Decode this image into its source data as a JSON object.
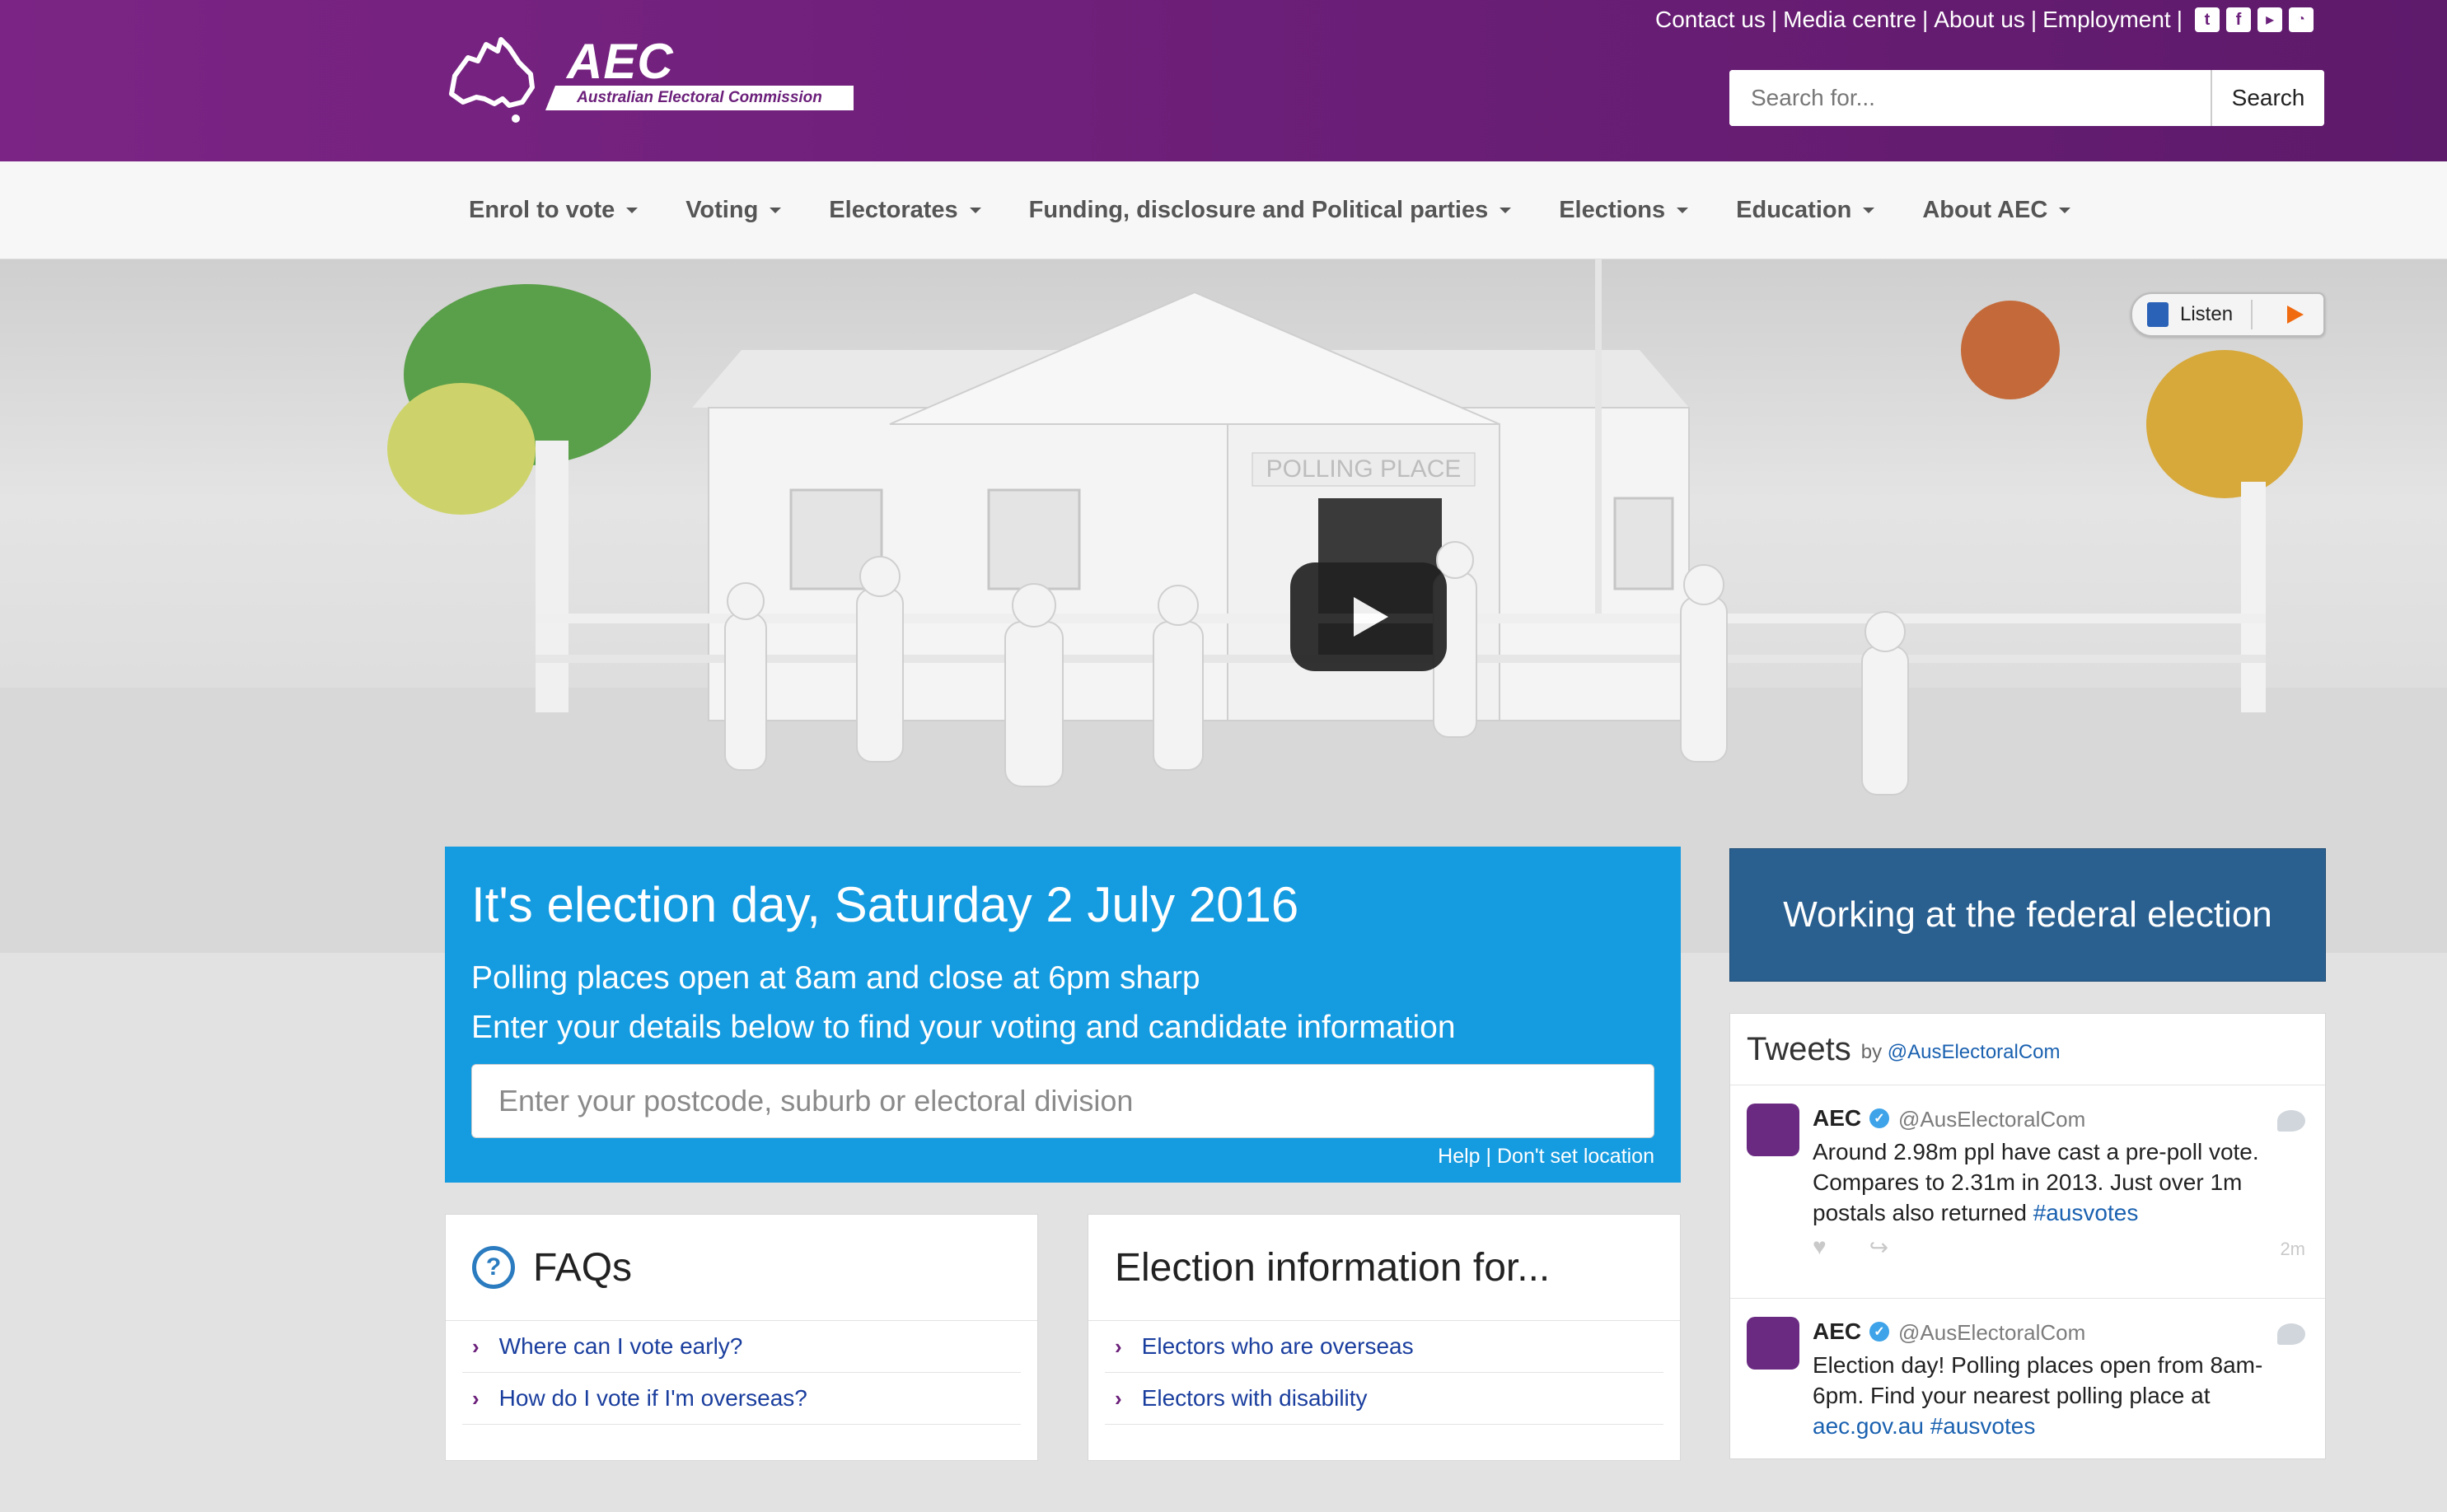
{
  "header": {
    "logo_text": "AEC",
    "logo_subtitle": "Australian Electoral Commission",
    "links": [
      "Contact us",
      "Media centre",
      "About us",
      "Employment"
    ],
    "link_separator": "|",
    "social_icons": [
      "twitter-icon",
      "facebook-icon",
      "youtube-icon",
      "rss-icon"
    ],
    "search": {
      "placeholder": "Search for...",
      "button_label": "Search"
    },
    "brand_color": "#6b1f7a"
  },
  "nav": {
    "items": [
      {
        "label": "Enrol to vote"
      },
      {
        "label": "Voting"
      },
      {
        "label": "Electorates"
      },
      {
        "label": "Funding, disclosure and Political parties"
      },
      {
        "label": "Elections"
      },
      {
        "label": "Education"
      },
      {
        "label": "About AEC"
      }
    ]
  },
  "hero": {
    "sign_text": "POLLING PLACE",
    "listen_label": "Listen",
    "play_icon": "play-icon"
  },
  "election": {
    "title": "It's election day, Saturday 2 July 2016",
    "line1": "Polling places open at 8am and close at 6pm sharp",
    "line2": "Enter your details below to find your voting and candidate information",
    "input_placeholder": "Enter your postcode, suburb or electoral division",
    "help_link": "Help",
    "separator": "|",
    "dont_set_link": "Don't set location",
    "accent_color": "#159be0"
  },
  "working": {
    "label": "Working at the federal election",
    "color": "#2a6090"
  },
  "tweets": {
    "title": "Tweets",
    "by": "by",
    "handle_link": "@AusElectoralCom",
    "items": [
      {
        "name": "AEC",
        "handle": "@AusElectoralCom",
        "text": "Around 2.98m ppl have cast a pre-poll vote. Compares to 2.31m in 2013. Just over 1m postals also returned ",
        "hashtag": "#ausvotes",
        "time": "2m"
      },
      {
        "name": "AEC",
        "handle": "@AusElectoralCom",
        "text": "Election day! Polling places open from 8am-6pm. Find your nearest polling place at ",
        "hashtag": "aec.gov.au #ausvotes",
        "time": ""
      }
    ]
  },
  "faqs": {
    "title": "FAQs",
    "items": [
      "Where can I vote early?",
      "How do I vote if I'm overseas?"
    ]
  },
  "election_info": {
    "title": "Election information for...",
    "items": [
      "Electors who are overseas",
      "Electors with disability"
    ]
  }
}
